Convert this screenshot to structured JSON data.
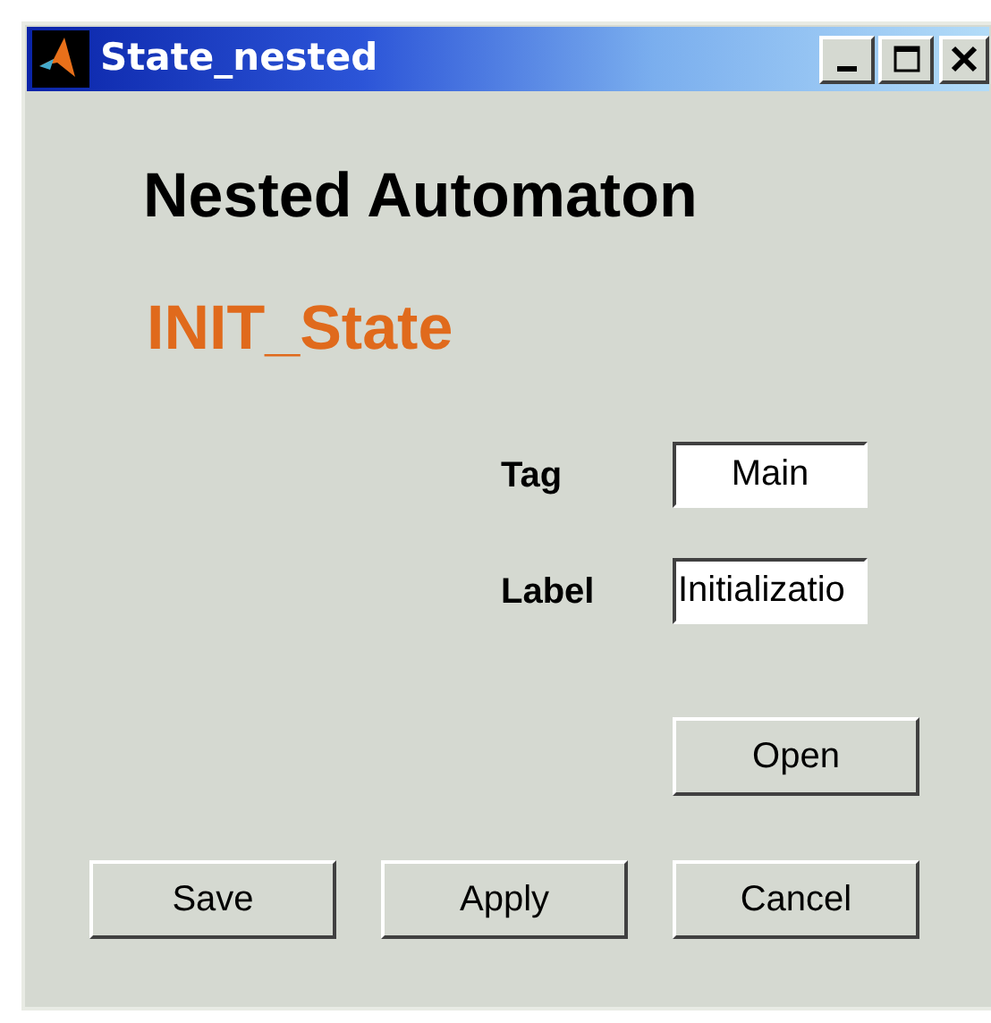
{
  "window": {
    "title": "State_nested"
  },
  "heading": "Nested Automaton",
  "state_name": "INIT_State",
  "fields": [
    {
      "label": "Tag",
      "value": "Main",
      "kind": "centered"
    },
    {
      "label": "Label",
      "value": "Initializatio",
      "kind": "plain"
    }
  ],
  "open_button": "Open",
  "buttons": [
    "Save",
    "Apply",
    "Cancel"
  ]
}
